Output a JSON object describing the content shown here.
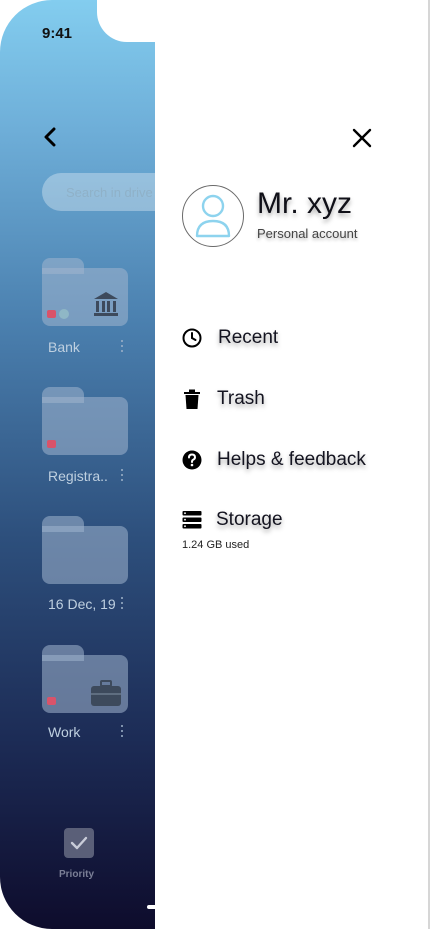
{
  "status_bar": {
    "time": "9:41"
  },
  "background": {
    "search": {
      "placeholder": "Search in drive"
    },
    "folders": [
      {
        "label": "Bank"
      },
      {
        "label": "Registra.."
      },
      {
        "label": "16 Dec, 19"
      },
      {
        "label": "Work"
      }
    ],
    "bottom_nav": {
      "priority_label": "Priority"
    }
  },
  "drawer": {
    "user": {
      "name": "Mr. xyz",
      "subtitle": "Personal account"
    },
    "menu": [
      {
        "label": "Recent",
        "icon": "clock-icon"
      },
      {
        "label": "Trash",
        "icon": "trash-icon"
      },
      {
        "label": "Helps & feedback",
        "icon": "help-icon"
      },
      {
        "label": "Storage",
        "icon": "storage-icon"
      }
    ],
    "storage_used": "1.24 GB used"
  },
  "colors": {
    "gradient_top": "#83cdef",
    "gradient_bottom": "#0e0c2c",
    "avatar_accent": "#8dd3ee",
    "lock_red": "#d9536a"
  }
}
